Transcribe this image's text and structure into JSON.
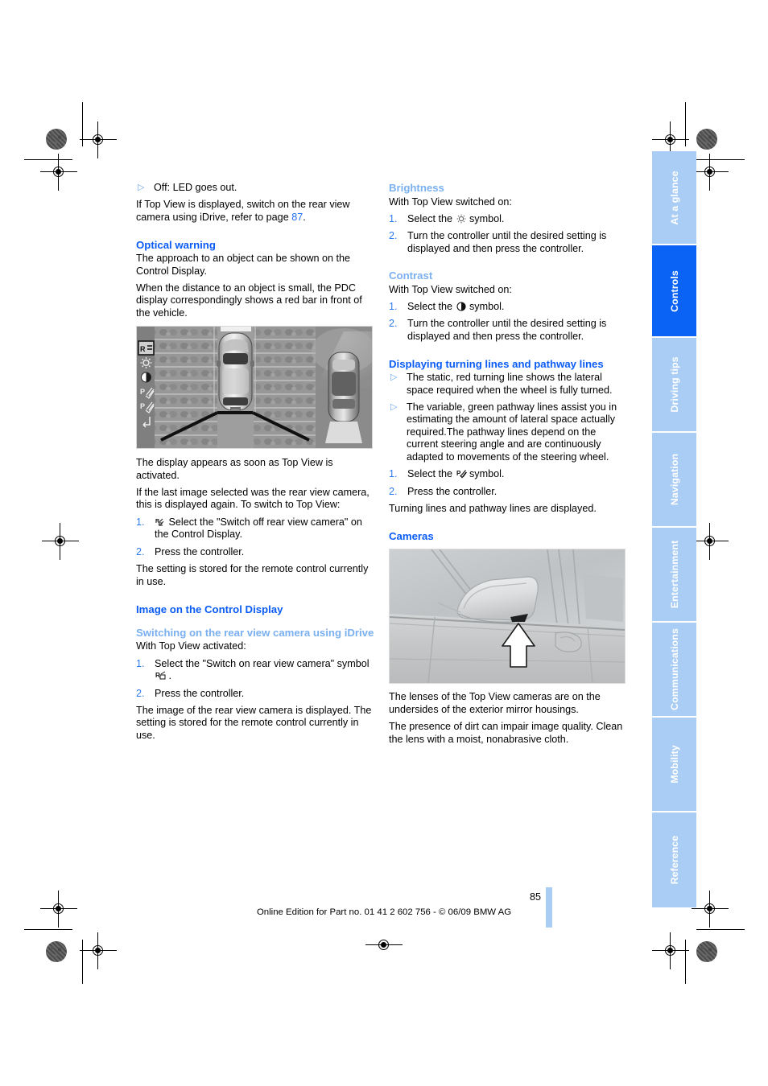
{
  "document": {
    "page_number": "85",
    "footer": "Online Edition for Part no. 01 41 2 602 756 - © 06/09 BMW AG",
    "accent_heading": "#0a5cf5",
    "accent_subheading": "#7ab0f0",
    "tab_active_color": "#0a63f5",
    "tab_inactive_color": "#aacdf5"
  },
  "sidebar": {
    "tabs": [
      {
        "label": "At a glance",
        "active": false
      },
      {
        "label": "Controls",
        "active": true
      },
      {
        "label": "Driving tips",
        "active": false
      },
      {
        "label": "Navigation",
        "active": false
      },
      {
        "label": "Entertainment",
        "active": false
      },
      {
        "label": "Communications",
        "active": false
      },
      {
        "label": "Mobility",
        "active": false
      },
      {
        "label": "Reference",
        "active": false
      }
    ]
  },
  "left_column": {
    "bullet_off": "Off: LED goes out.",
    "intro_p1_a": "If Top View is displayed, switch on the rear view camera using iDrive, refer to page ",
    "intro_p1_ref": "87",
    "intro_p1_b": ".",
    "optical_warning": {
      "heading": "Optical warning",
      "p1": "The approach to an object can be shown on the Control Display.",
      "p2": "When the distance to an object is small, the PDC display correspondingly shows a red bar in front of the vehicle."
    },
    "figure_topview": {
      "name": "top-view-pdc-display",
      "icons": [
        "rear-view-camera-icon",
        "brightness-icon",
        "contrast-icon",
        "pathway-lines-icon",
        "turning-lines-icon",
        "back-icon"
      ]
    },
    "after_figure": {
      "p1": "The display appears as soon as Top View is activated.",
      "p2": "If the last image selected was the rear view camera, this is displayed again. To switch to Top View:",
      "step1_num": "1.",
      "step1_text": "Select the \"Switch off rear view camera\" on the Control Display.",
      "step2_num": "2.",
      "step2_text": "Press the controller.",
      "p3": "The setting is stored for the remote control currently in use."
    },
    "image_on_control_display": {
      "heading": "Image on the Control Display",
      "sub_heading": "Switching on the rear view camera using iDrive",
      "p1": "With Top View activated:",
      "step1_num": "1.",
      "step1_text_a": "Select the \"Switch on rear view camera\" symbol ",
      "step1_text_b": " .",
      "step2_num": "2.",
      "step2_text": "Press the controller.",
      "p2": "The image of the rear view camera is displayed. The setting is stored for the remote control currently in use."
    }
  },
  "right_column": {
    "brightness": {
      "heading": "Brightness",
      "p1": "With Top View switched on:",
      "step1_num": "1.",
      "step1_text_a": "Select the ",
      "step1_text_b": " symbol.",
      "step2_num": "2.",
      "step2_text": "Turn the controller until the desired setting is displayed and then press the controller."
    },
    "contrast": {
      "heading": "Contrast",
      "p1": "With Top View switched on:",
      "step1_num": "1.",
      "step1_text_a": "Select the ",
      "step1_text_b": " symbol.",
      "step2_num": "2.",
      "step2_text": "Turn the controller until the desired setting is displayed and then press the controller."
    },
    "turning_lines": {
      "heading": "Displaying turning lines and pathway lines",
      "bullet1": "The static, red turning line shows the lateral space required when the wheel is fully turned.",
      "bullet2": "The variable, green pathway lines assist you in estimating the amount of lateral space actually required.",
      "bullet2_cont": "The pathway lines depend on the current steering angle and are continuously adapted to movements of the steering wheel.",
      "step1_num": "1.",
      "step1_text_a": "Select the ",
      "step1_text_b": " symbol.",
      "step2_num": "2.",
      "step2_text": "Press the controller.",
      "p1": "Turning lines and pathway lines are displayed."
    },
    "cameras": {
      "heading": "Cameras",
      "figure_name": "exterior-mirror-camera-photo",
      "p1": "The lenses of the Top View cameras are on the undersides of the exterior mirror housings.",
      "p2": "The presence of dirt can impair image quality. Clean the lens with a moist, nonabrasive cloth."
    }
  }
}
